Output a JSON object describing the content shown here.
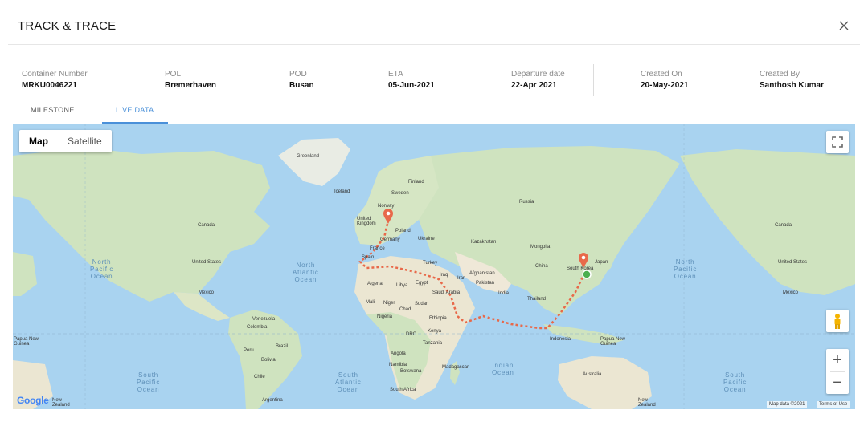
{
  "header": {
    "title": "TRACK & TRACE",
    "close_label": "×"
  },
  "info": {
    "container_number": {
      "label": "Container Number",
      "value": "MRKU0046221"
    },
    "pol": {
      "label": "POL",
      "value": "Bremerhaven"
    },
    "pod": {
      "label": "POD",
      "value": "Busan"
    },
    "eta": {
      "label": "ETA",
      "value": "05-Jun-2021"
    },
    "departure": {
      "label": "Departure date",
      "value": "22-Apr 2021"
    },
    "created_on": {
      "label": "Created On",
      "value": "20-May-2021"
    },
    "created_by": {
      "label": "Created By",
      "value": "Santhosh Kumar"
    }
  },
  "tabs": [
    {
      "label": "MILESTONE",
      "active": false
    },
    {
      "label": "LIVE DATA",
      "active": true
    }
  ],
  "map": {
    "type_buttons": {
      "map": "Map",
      "satellite": "Satellite",
      "selected": "Map"
    },
    "zoom_in": "+",
    "zoom_out": "−",
    "route_color": "#e8694a",
    "marker_color": "#e8694a",
    "vessel_color": "#4caf50",
    "labels": {
      "greenland": "Greenland",
      "iceland": "Iceland",
      "finland": "Finland",
      "sweden": "Sweden",
      "norway": "Norway",
      "russia": "Russia",
      "united_kingdom": "United\nKingdom",
      "poland": "Poland",
      "ukraine": "Ukraine",
      "germany": "Germany",
      "france": "France",
      "spain": "Spain",
      "kazakhstan": "Kazakhstan",
      "mongolia": "Mongolia",
      "turkey": "Turkey",
      "afghanistan": "Afghanistan",
      "iran": "Iran",
      "iraq": "Iraq",
      "pakistan": "Pakistan",
      "china": "China",
      "japan": "Japan",
      "south_korea": "South Korea",
      "algeria": "Algeria",
      "libya": "Libya",
      "egypt": "Egypt",
      "saudi_arabia": "Saudi Arabia",
      "india": "India",
      "thailand": "Thailand",
      "mali": "Mali",
      "niger": "Niger",
      "chad": "Chad",
      "sudan": "Sudan",
      "nigeria": "Nigeria",
      "ethiopia": "Ethiopia",
      "kenya": "Kenya",
      "drc": "DRC",
      "tanzania": "Tanzania",
      "indonesia": "Indonesia",
      "papua": "Papua New\nGuinea",
      "angola": "Angola",
      "namibia": "Namibia",
      "botswana": "Botswana",
      "madagascar": "Madagascar",
      "south_africa": "South Africa",
      "australia": "Australia",
      "canada": "Canada",
      "united_states": "United States",
      "mexico": "Mexico",
      "venezuela": "Venezuela",
      "colombia": "Colombia",
      "peru": "Peru",
      "brazil": "Brazil",
      "bolivia": "Bolivia",
      "chile": "Chile",
      "argentina": "Argentina",
      "canada_r": "Canada",
      "united_states_r": "United States",
      "mexico_r": "Mexico",
      "papua_l": "Papua New\nGuinea",
      "new_zealand": "New\nZealand",
      "new_zealand_l": "New\nZealand"
    },
    "oceans": {
      "north_pacific_l": "North\nPacific\nOcean",
      "north_atlantic": "North\nAtlantic\nOcean",
      "north_pacific_r": "North\nPacific\nOcean",
      "south_pacific_l": "South\nPacific\nOcean",
      "south_atlantic": "South\nAtlantic\nOcean",
      "indian": "Indian\nOcean",
      "south_pacific_r": "South\nPacific\nOcean"
    },
    "attribution": {
      "google": "Google",
      "map_data": "Map data ©2021",
      "terms": "Terms of Use"
    }
  }
}
